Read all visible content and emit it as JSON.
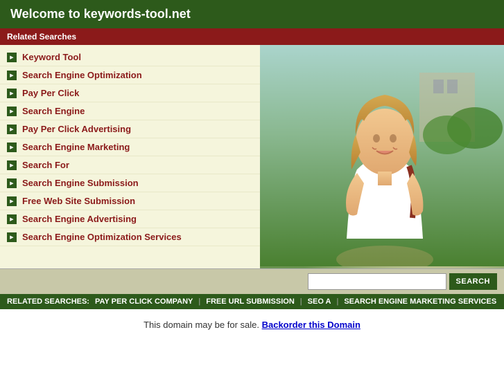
{
  "header": {
    "title": "Welcome to keywords-tool.net"
  },
  "related_searches_header": {
    "label": "Related Searches"
  },
  "list_items": [
    {
      "id": 1,
      "label": "Keyword Tool"
    },
    {
      "id": 2,
      "label": "Search Engine Optimization"
    },
    {
      "id": 3,
      "label": "Pay Per Click"
    },
    {
      "id": 4,
      "label": "Search Engine"
    },
    {
      "id": 5,
      "label": "Pay Per Click Advertising"
    },
    {
      "id": 6,
      "label": "Search Engine Marketing"
    },
    {
      "id": 7,
      "label": "Search For"
    },
    {
      "id": 8,
      "label": "Search Engine Submission"
    },
    {
      "id": 9,
      "label": "Free Web Site Submission"
    },
    {
      "id": 10,
      "label": "Search Engine Advertising"
    },
    {
      "id": 11,
      "label": "Search Engine Optimization Services"
    }
  ],
  "search_bar": {
    "placeholder": "",
    "button_label": "SEARCH"
  },
  "related_footer": {
    "label": "RELATED SEARCHES:",
    "links": [
      {
        "text": "PAY PER CLICK COMPANY"
      },
      {
        "text": "FREE URL SUBMISSION"
      },
      {
        "text": "SEO A"
      },
      {
        "text": "SEARCH ENGINE MARKETING SERVICES"
      }
    ]
  },
  "sale_notice": {
    "text": "This domain may be for sale.",
    "link_text": "Backorder this Domain"
  }
}
